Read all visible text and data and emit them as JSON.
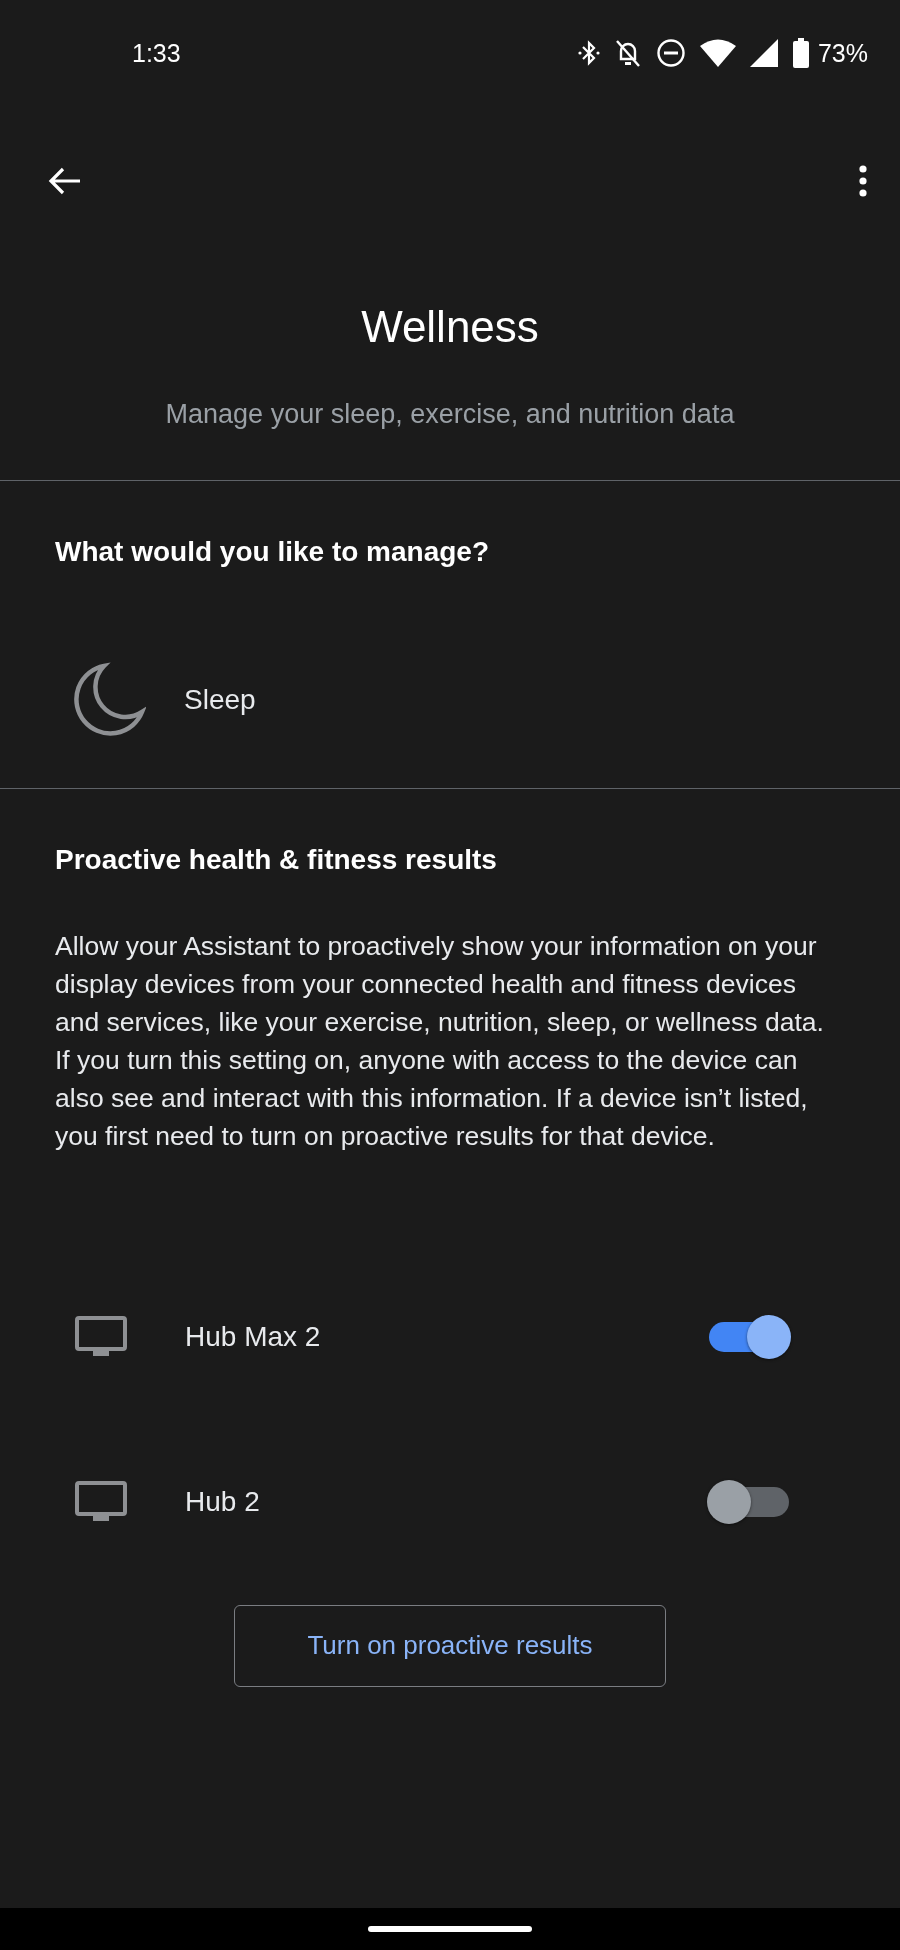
{
  "status_bar": {
    "time": "1:33",
    "battery": "73%"
  },
  "header": {
    "title": "Wellness",
    "subtitle": "Manage your sleep, exercise, and nutrition data"
  },
  "manage": {
    "heading": "What would you like to manage?",
    "items": [
      {
        "label": "Sleep"
      }
    ]
  },
  "proactive": {
    "heading": "Proactive health & fitness results",
    "description": "Allow your Assistant to proactively show your information on your display devices from your connected health and fitness devices and services, like your exercise, nutrition, sleep, or wellness data. If you turn this setting on, anyone with access to the device can also see and interact with this information. If a device isn’t listed, you first need to turn on proactive results for that device.",
    "devices": [
      {
        "name": "Hub Max 2",
        "on": true
      },
      {
        "name": "Hub 2",
        "on": false
      }
    ],
    "button": "Turn on proactive results"
  }
}
